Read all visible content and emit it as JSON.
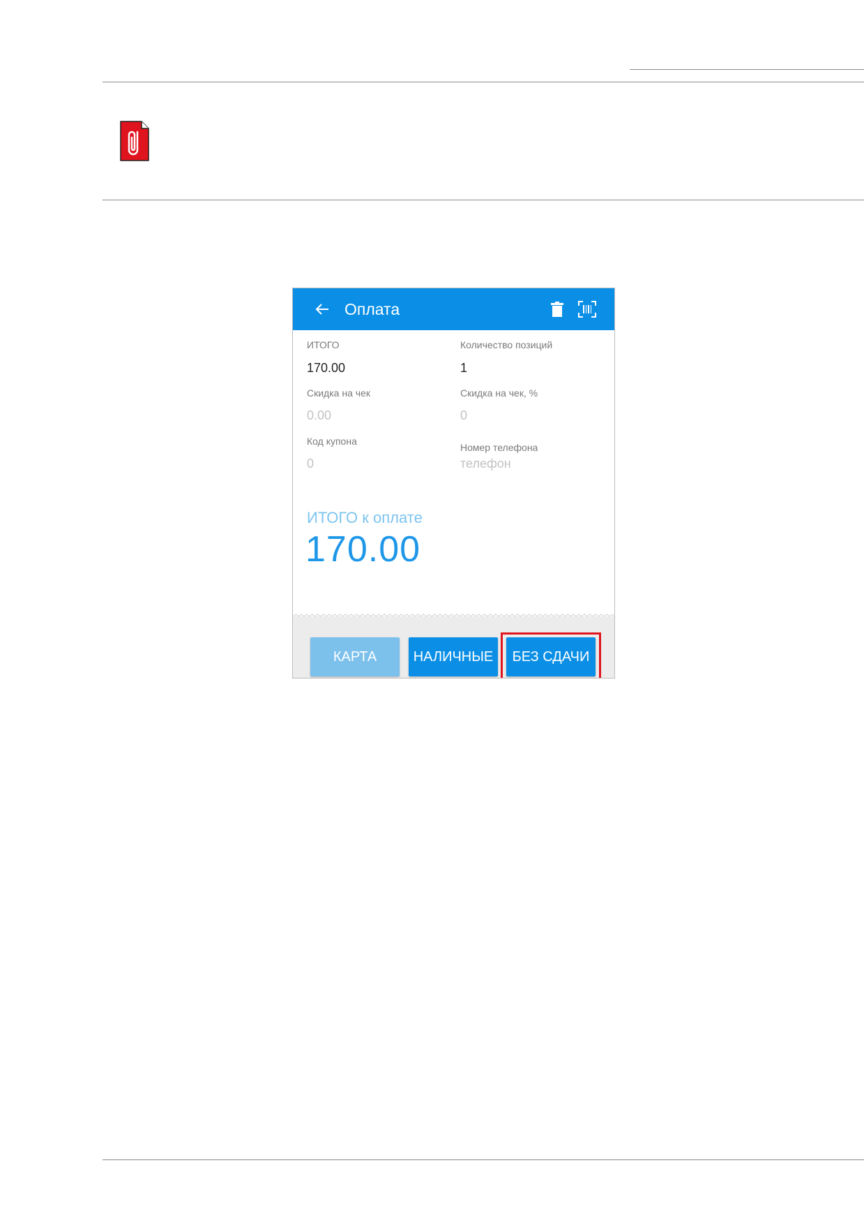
{
  "screen": {
    "title": "Оплата",
    "icons": [
      "back-arrow-icon",
      "trash-icon",
      "barcode-scan-icon"
    ]
  },
  "fields": {
    "total_label": "ИТОГО",
    "total_value": "170.00",
    "positions_label": "Количество позиций",
    "positions_value": "1",
    "discount_label": "Скидка на чек",
    "discount_value": "0.00",
    "discount_pct_label": "Скидка на чек, %",
    "discount_pct_value": "0",
    "coupon_label": "Код купона",
    "coupon_value": "0",
    "phone_label": "Номер телефона",
    "phone_placeholder": "телефон"
  },
  "payment": {
    "total_due_label": "ИТОГО к оплате",
    "total_due_value": "170.00"
  },
  "buttons": {
    "card": "КАРТА",
    "cash": "НАЛИЧНЫЕ",
    "no_change": "БЕЗ СДАЧИ"
  },
  "colors": {
    "appbar": "#0b8fe6",
    "button_primary": "#0b8fe6",
    "button_disabled": "#7cc0ec",
    "highlight": "#e0141e",
    "note_icon": "#e0141e"
  }
}
